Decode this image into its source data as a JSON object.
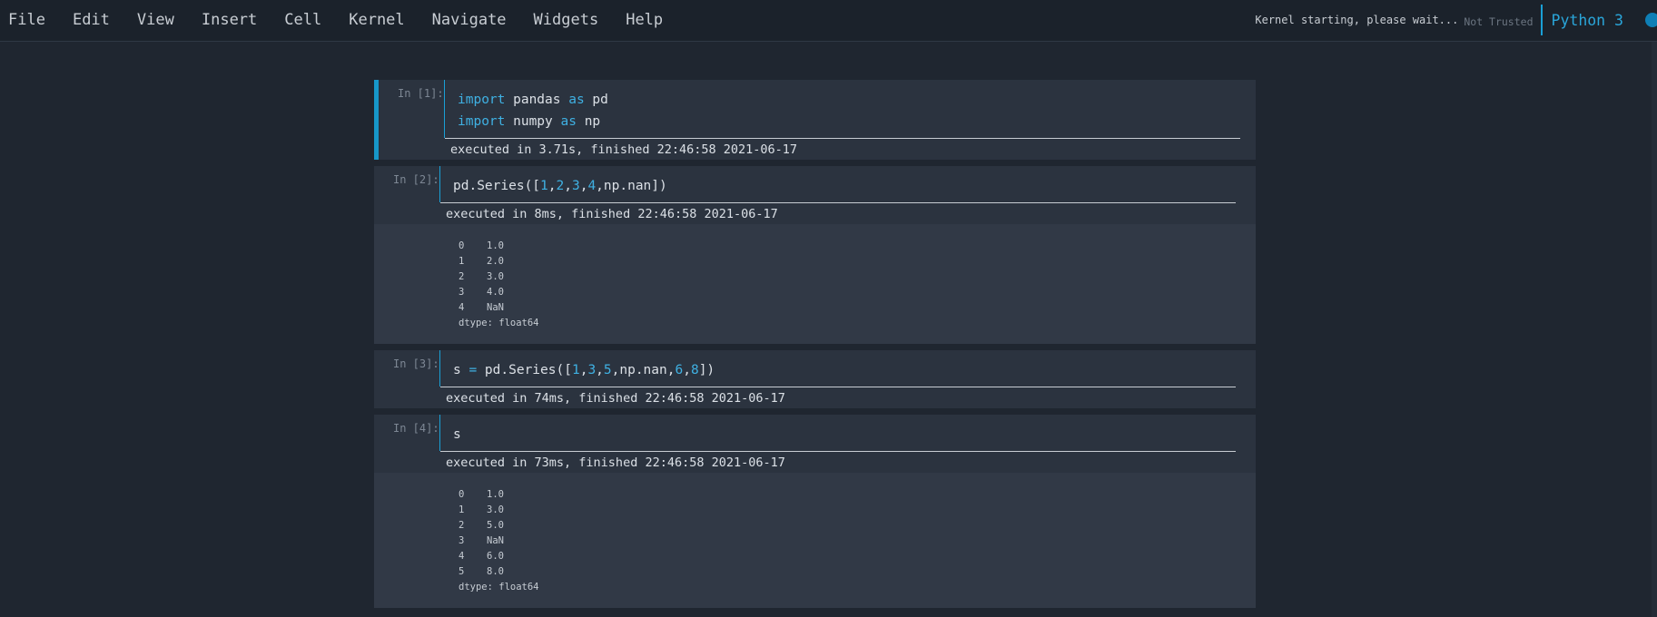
{
  "menu": [
    "File",
    "Edit",
    "View",
    "Insert",
    "Cell",
    "Kernel",
    "Navigate",
    "Widgets",
    "Help"
  ],
  "kernel": {
    "status": "Kernel starting, please wait...",
    "trust": "Not Trusted",
    "name": "Python 3"
  },
  "cells": [
    {
      "prompt": "In [1]:",
      "lines": [
        [
          {
            "t": "import",
            "c": "kw"
          },
          {
            "t": " pandas "
          },
          {
            "t": "as",
            "c": "kw"
          },
          {
            "t": " pd"
          }
        ],
        [
          {
            "t": "import",
            "c": "kw"
          },
          {
            "t": " numpy "
          },
          {
            "t": "as",
            "c": "kw"
          },
          {
            "t": " np"
          }
        ]
      ],
      "exec": "executed in 3.71s, finished 22:46:58 2021-06-17"
    },
    {
      "prompt": "In [2]:",
      "lines": [
        [
          {
            "t": "pd.Series(["
          },
          {
            "t": "1",
            "c": "num"
          },
          {
            "t": ","
          },
          {
            "t": "2",
            "c": "num"
          },
          {
            "t": ","
          },
          {
            "t": "3",
            "c": "num"
          },
          {
            "t": ","
          },
          {
            "t": "4",
            "c": "num"
          },
          {
            "t": ",np.nan])"
          }
        ]
      ],
      "exec": "executed in 8ms, finished 22:46:58 2021-06-17",
      "output": {
        "rows": [
          [
            "0",
            "1.0"
          ],
          [
            "1",
            "2.0"
          ],
          [
            "2",
            "3.0"
          ],
          [
            "3",
            "4.0"
          ],
          [
            "4",
            "NaN"
          ]
        ],
        "dtype": "dtype: float64"
      }
    },
    {
      "prompt": "In [3]:",
      "lines": [
        [
          {
            "t": "s "
          },
          {
            "t": "=",
            "c": "kw"
          },
          {
            "t": " pd.Series(["
          },
          {
            "t": "1",
            "c": "num"
          },
          {
            "t": ","
          },
          {
            "t": "3",
            "c": "num"
          },
          {
            "t": ","
          },
          {
            "t": "5",
            "c": "num"
          },
          {
            "t": ",np.nan,"
          },
          {
            "t": "6",
            "c": "num"
          },
          {
            "t": ","
          },
          {
            "t": "8",
            "c": "num"
          },
          {
            "t": "])"
          }
        ]
      ],
      "exec": "executed in 74ms, finished 22:46:58 2021-06-17"
    },
    {
      "prompt": "In [4]:",
      "lines": [
        [
          {
            "t": "s"
          }
        ]
      ],
      "exec": "executed in 73ms, finished 22:46:58 2021-06-17",
      "output": {
        "rows": [
          [
            "0",
            "1.0"
          ],
          [
            "1",
            "3.0"
          ],
          [
            "2",
            "5.0"
          ],
          [
            "3",
            "NaN"
          ],
          [
            "4",
            "6.0"
          ],
          [
            "5",
            "8.0"
          ]
        ],
        "dtype": "dtype: float64"
      }
    }
  ]
}
